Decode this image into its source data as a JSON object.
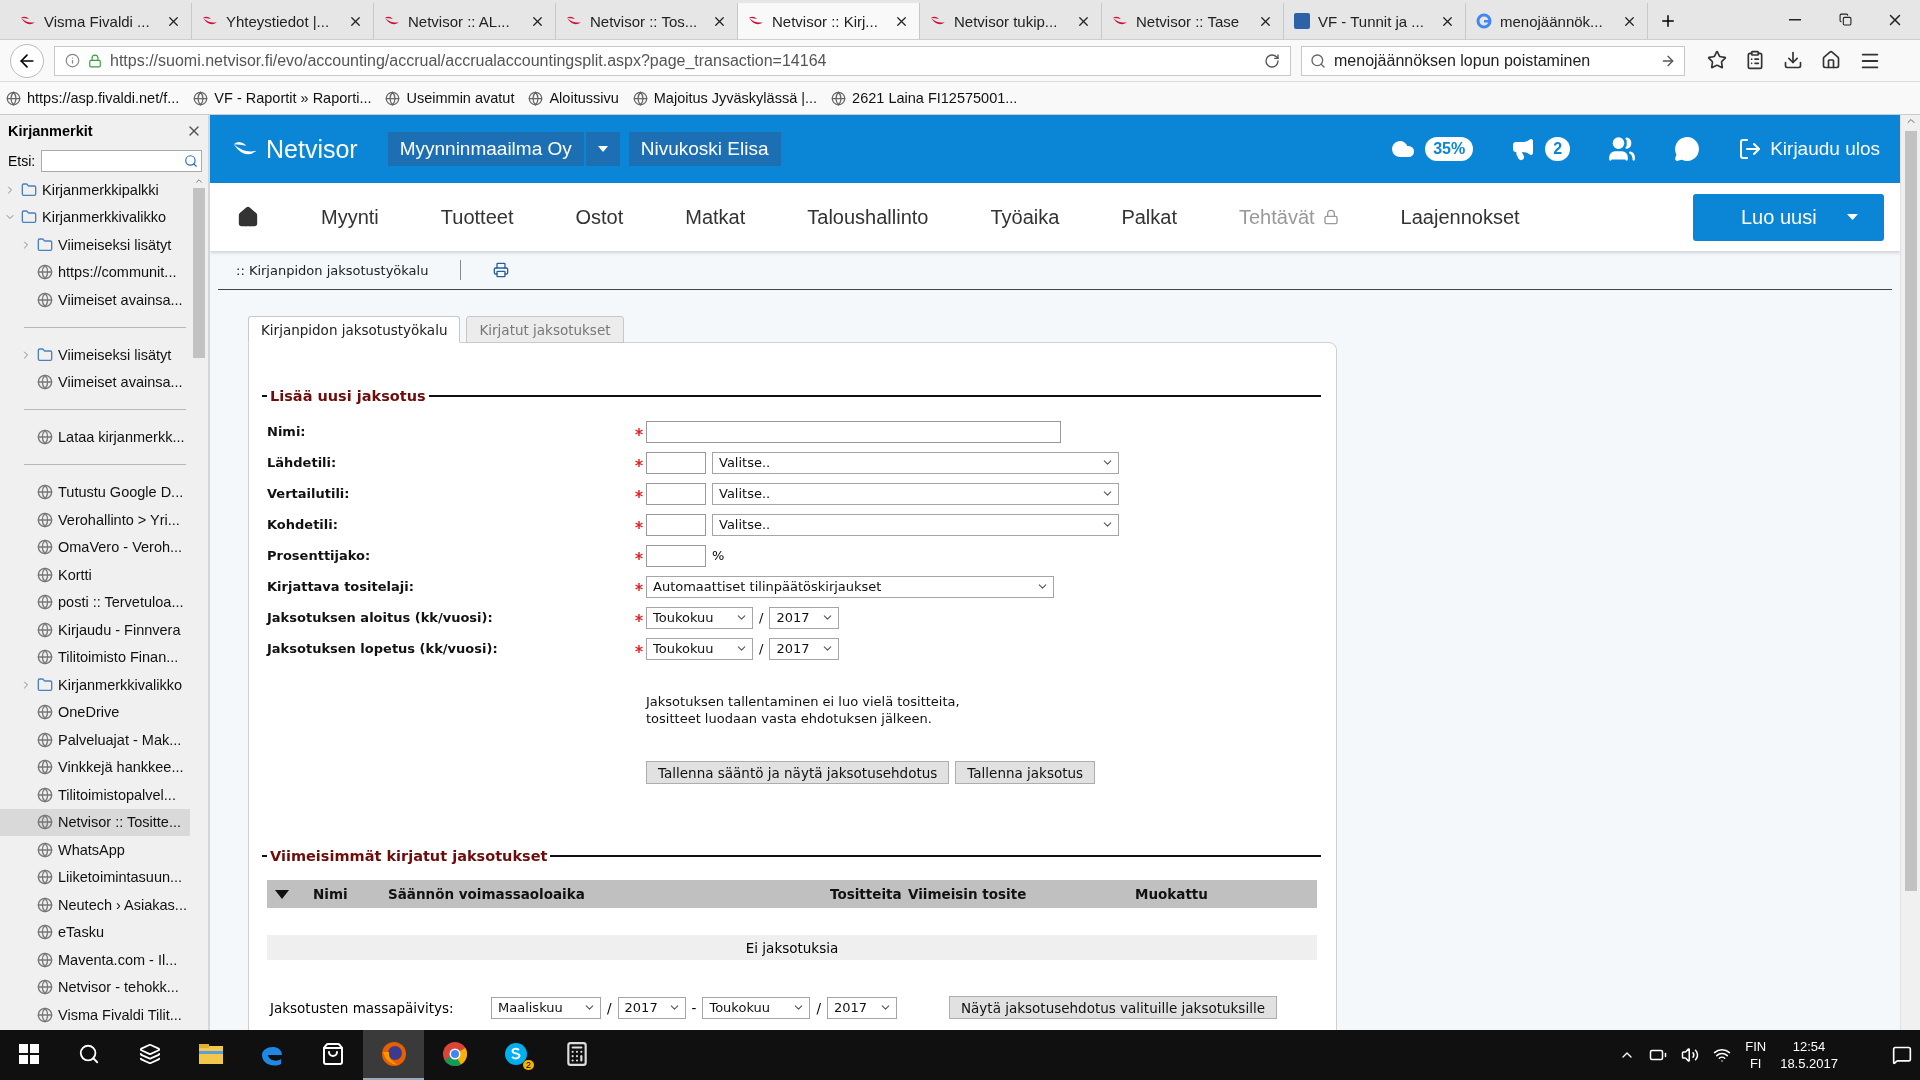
{
  "browser": {
    "tabs": [
      {
        "title": "Visma Fivaldi ...",
        "kind": "swoosh",
        "selected": false
      },
      {
        "title": "Yhteystiedot |...",
        "kind": "swoosh",
        "selected": false
      },
      {
        "title": "Netvisor :: AL...",
        "kind": "swoosh",
        "selected": false
      },
      {
        "title": "Netvisor :: Tos...",
        "kind": "swoosh",
        "selected": false
      },
      {
        "title": "Netvisor :: Kirj...",
        "kind": "swoosh",
        "selected": true
      },
      {
        "title": "Netvisor tukip...",
        "kind": "swoosh",
        "selected": false
      },
      {
        "title": "Netvisor :: Tase",
        "kind": "swoosh",
        "selected": false
      },
      {
        "title": "VF - Tunnit ja ...",
        "kind": "square",
        "selected": false
      },
      {
        "title": "menojäännök...",
        "kind": "circle",
        "selected": false
      }
    ],
    "url": "https://suomi.netvisor.fi/evo/accounting/accrual/accrualaccountingsplit.aspx?page_transaction=14164",
    "search": "menojäännöksen lopun poistaminen",
    "bookmarks": [
      "https://asp.fivaldi.net/f...",
      "VF - Raportit » Raporti...",
      "Useimmin avatut",
      "Aloitussivu",
      "Majoitus Jyväskylässä |...",
      "2621 Laina FI12575001..."
    ]
  },
  "sidebar": {
    "title": "Kirjanmerkit",
    "search_label": "Etsi:",
    "items": [
      {
        "kind": "folder",
        "label": "Kirjanmerkkipalkki",
        "expanded": false,
        "selected": false
      },
      {
        "kind": "folder",
        "label": "Kirjanmerkkivalikko",
        "expanded": true,
        "selected": false,
        "children": [
          {
            "kind": "folder",
            "label": "Viimeiseksi lisätyt",
            "expanded": false,
            "selected": false
          },
          {
            "kind": "link",
            "label": "https://communit...",
            "selected": false
          },
          {
            "kind": "link",
            "label": "Viimeiset avainsa...",
            "selected": false
          },
          {
            "kind": "separator"
          },
          {
            "kind": "folder",
            "label": "Viimeiseksi lisätyt",
            "expanded": false,
            "selected": false
          },
          {
            "kind": "link",
            "label": "Viimeiset avainsa...",
            "selected": false
          },
          {
            "kind": "separator"
          },
          {
            "kind": "link",
            "label": "Lataa kirjanmerkk...",
            "selected": false
          },
          {
            "kind": "separator"
          },
          {
            "kind": "link",
            "label": "Tutustu Google D...",
            "selected": false
          },
          {
            "kind": "link",
            "label": "Verohallinto > Yri...",
            "selected": false
          },
          {
            "kind": "link",
            "label": "OmaVero - Veroh...",
            "selected": false
          },
          {
            "kind": "link",
            "label": "Kortti",
            "selected": false
          },
          {
            "kind": "link",
            "label": "posti :: Tervetuloa...",
            "selected": false
          },
          {
            "kind": "link",
            "label": "Kirjaudu - Finnvera",
            "selected": false
          },
          {
            "kind": "link",
            "label": "Tilitoimisto Finan...",
            "selected": false
          },
          {
            "kind": "folder",
            "label": "Kirjanmerkkivalikko",
            "expanded": false,
            "selected": false
          },
          {
            "kind": "link",
            "label": "OneDrive",
            "selected": false
          },
          {
            "kind": "link",
            "label": "Palveluajat - Mak...",
            "selected": false
          },
          {
            "kind": "link",
            "label": "Vinkkejä hankkee...",
            "selected": false
          },
          {
            "kind": "link",
            "label": "Tilitoimistopalvel...",
            "selected": false
          },
          {
            "kind": "link",
            "label": "Netvisor :: Tositte...",
            "selected": true
          },
          {
            "kind": "link",
            "label": "WhatsApp",
            "selected": false
          },
          {
            "kind": "link",
            "label": "Liiketoimintasuun...",
            "selected": false
          },
          {
            "kind": "link",
            "label": "Neutech › Asiakas...",
            "selected": false
          },
          {
            "kind": "link",
            "label": "eTasku",
            "selected": false
          },
          {
            "kind": "link",
            "label": "Maventa.com - Il...",
            "selected": false
          },
          {
            "kind": "link",
            "label": "Netvisor - tehokk...",
            "selected": false
          },
          {
            "kind": "link",
            "label": "Visma Fivaldi Tilit...",
            "selected": false
          }
        ]
      }
    ]
  },
  "app": {
    "logo": "Netvisor",
    "company": "Myynninmaailma Oy",
    "user": "Nivukoski Elisa",
    "storage": "35%",
    "notifications": "2",
    "logout": "Kirjaudu ulos",
    "menu": [
      {
        "label": "Myynti",
        "disabled": false
      },
      {
        "label": "Tuotteet",
        "disabled": false
      },
      {
        "label": "Ostot",
        "disabled": false
      },
      {
        "label": "Matkat",
        "disabled": false
      },
      {
        "label": "Taloushallinto",
        "disabled": false
      },
      {
        "label": "Työaika",
        "disabled": false
      },
      {
        "label": "Palkat",
        "disabled": false
      },
      {
        "label": "Tehtävät",
        "disabled": true
      },
      {
        "label": "Laajennokset",
        "disabled": false
      }
    ],
    "create_button": "Luo uusi",
    "breadcrumb": ":: Kirjanpidon jaksotustyökalu"
  },
  "page": {
    "tabs": [
      {
        "label": "Kirjanpidon jaksotustyökalu",
        "selected": true
      },
      {
        "label": "Kirjatut jaksotukset",
        "selected": false
      }
    ],
    "new_section": {
      "title": "Lisää uusi jaksotus",
      "fields": [
        {
          "kind": "text",
          "label": "Nimi:",
          "required": true
        },
        {
          "kind": "account",
          "label": "Lähdetili:",
          "required": true,
          "value": "Valitse.."
        },
        {
          "kind": "account",
          "label": "Vertailutili:",
          "required": true,
          "value": "Valitse.."
        },
        {
          "kind": "account",
          "label": "Kohdetili:",
          "required": true,
          "value": "Valitse.."
        },
        {
          "kind": "percent",
          "label": "Prosenttijako:",
          "required": true,
          "unit": "%"
        },
        {
          "kind": "select",
          "label": "Kirjattava tositelaji:",
          "required": true,
          "value": "Automaattiset tilinpäätöskirjaukset"
        },
        {
          "kind": "period",
          "label": "Jaksotuksen aloitus (kk/vuosi):",
          "required": true,
          "month": "Toukokuu",
          "separator": "/",
          "year": "2017"
        },
        {
          "kind": "period",
          "label": "Jaksotuksen lopetus (kk/vuosi):",
          "required": true,
          "month": "Toukokuu",
          "separator": "/",
          "year": "2017"
        }
      ],
      "note": [
        "Jaksotuksen tallentaminen ei luo vielä tositteita,",
        "tositteet luodaan vasta ehdotuksen jälkeen."
      ],
      "buttons": [
        "Tallenna sääntö ja näytä jaksotusehdotus",
        "Tallenna jaksotus"
      ]
    },
    "recent_section": {
      "title": "Viimeisimmät kirjatut jaksotukset",
      "columns": [
        "Nimi",
        "Säännön voimassaoloaika",
        "Tositteita",
        "Viimeisin tosite",
        "Muokattu"
      ],
      "empty": "Ei jaksotuksia",
      "mass_update": {
        "label": "Jaksotusten massapäivitys:",
        "from_month": "Maaliskuu",
        "from_year": "2017",
        "range_separator": "-",
        "to_month": "Toukokuu",
        "to_year": "2017",
        "separator": "/",
        "button": "Näytä jaksotusehdotus valituille jaksotuksille"
      }
    }
  },
  "taskbar": {
    "apps": [
      {
        "kind": "explorer",
        "active": false
      },
      {
        "kind": "edge",
        "active": false
      },
      {
        "kind": "store",
        "active": false
      },
      {
        "kind": "firefox",
        "active": true
      },
      {
        "kind": "chrome",
        "active": false
      },
      {
        "kind": "skype",
        "active": false,
        "badge": "2"
      },
      {
        "kind": "calculator",
        "active": false
      }
    ],
    "language": "FIN",
    "keyboard": "FI",
    "time": "12:54",
    "date": "18.5.2017"
  }
}
